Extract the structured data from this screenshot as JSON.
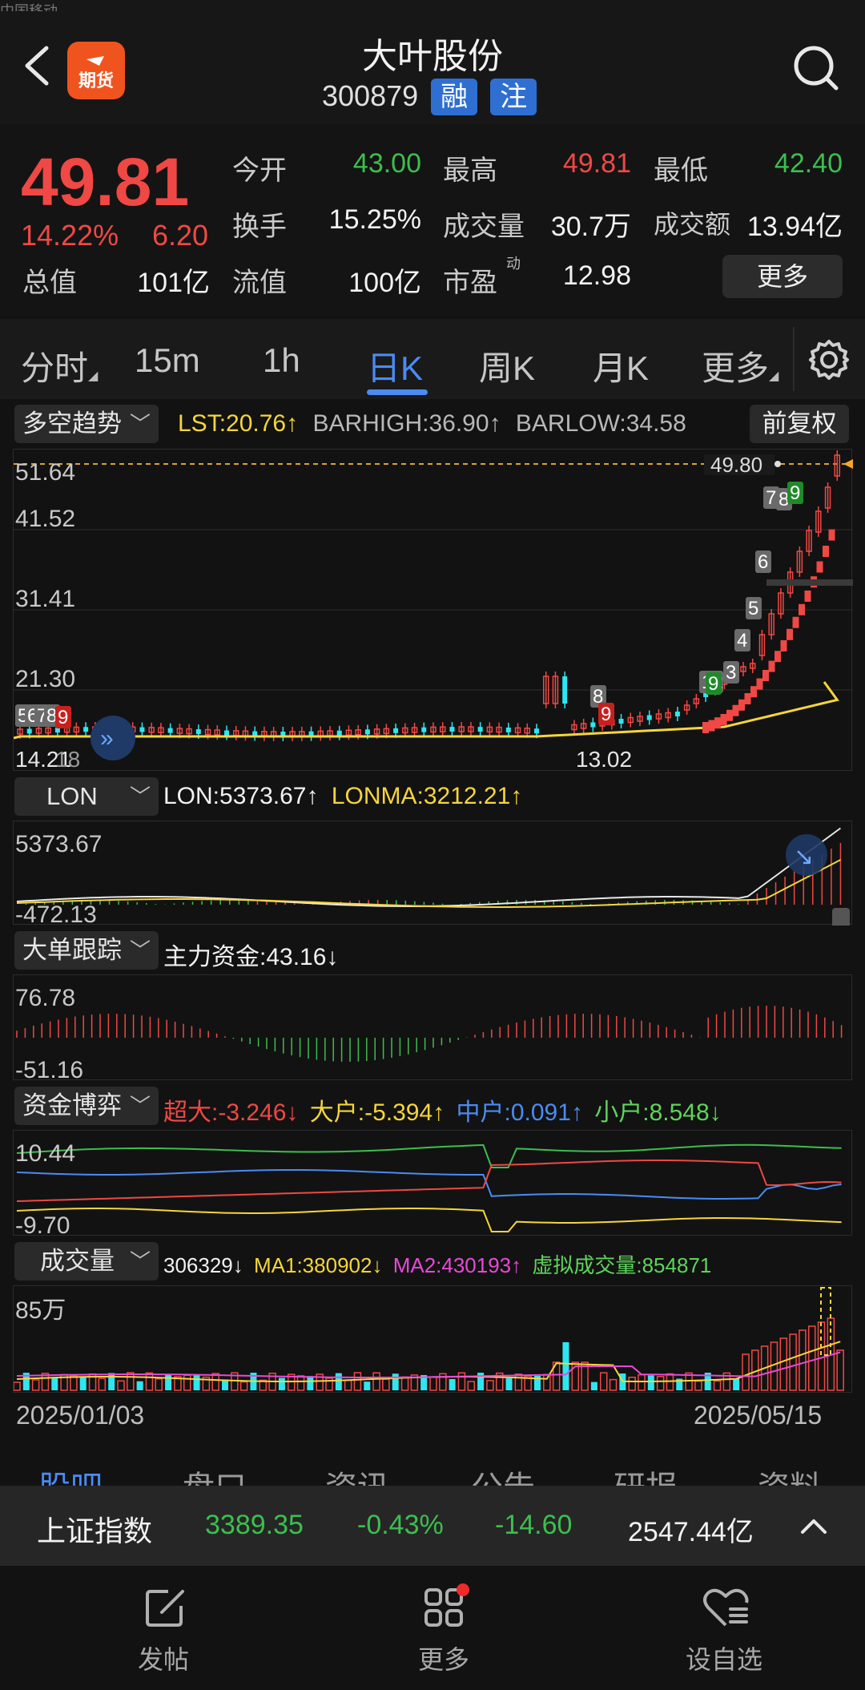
{
  "header": {
    "statusbar_text": "中国移动",
    "title": "大叶股份",
    "code": "300879",
    "tags": [
      "融",
      "注"
    ],
    "back_label": "‹",
    "futures_label": "期货"
  },
  "quote": {
    "price": "49.81",
    "change_pct": "14.22%",
    "change": "6.20",
    "rows": [
      [
        {
          "label": "今开",
          "value": "43.00",
          "color": "green"
        },
        {
          "label": "最高",
          "value": "49.81",
          "color": "red"
        },
        {
          "label": "最低",
          "value": "42.40",
          "color": "green"
        }
      ],
      [
        {
          "label": "换手",
          "value": "15.25%",
          "color": "white"
        },
        {
          "label": "成交量",
          "value": "30.7万",
          "color": "white"
        },
        {
          "label": "成交额",
          "value": "13.94亿",
          "color": "white"
        }
      ]
    ],
    "total_value_label": "总值",
    "total_value": "101亿",
    "float_value_label": "流值",
    "float_value": "100亿",
    "pe_label": "市盈",
    "pe_sup": "动",
    "pe_value": "12.98",
    "more_button": "更多"
  },
  "tabs": [
    "分时",
    "15m",
    "1h",
    "日K",
    "周K",
    "月K",
    "更多"
  ],
  "active_tab": "日K",
  "kline": {
    "indicator": "多空趋势",
    "lst": "LST:20.76↑",
    "barhigh": "BARHIGH:36.90↑",
    "barlow": "BARLOW:34.58",
    "fq_button": "前复权",
    "y_labels": [
      "51.64",
      "41.52",
      "31.41",
      "21.30"
    ],
    "last_price_tag": "49.80",
    "low_label_left": "14.21",
    "low_label_left2": "18",
    "low_label_mid": "13.02"
  },
  "lon": {
    "indicator": "LON",
    "lon": "LON:5373.67↑",
    "lonma": "LONMA:3212.21↑",
    "y_top": "5373.67",
    "y_bottom": "-472.13"
  },
  "bigorder": {
    "indicator": "大单跟踪",
    "main": "主力资金:43.16↓",
    "y_top": "76.78",
    "y_bottom": "-51.16"
  },
  "funds": {
    "indicator": "资金博弈",
    "super": "超大:-3.246↓",
    "large": "大户:-5.394↑",
    "medium": "中户:0.091↑",
    "small": "小户:8.548↓",
    "y_top": "10.44",
    "y_bottom": "-9.70"
  },
  "volume": {
    "indicator": "成交量",
    "vol": "306329↓",
    "ma1": "MA1:380902↓",
    "ma2": "MA2:430193↑",
    "virtual": "虚拟成交量:854871",
    "y_top": "85万"
  },
  "dates": {
    "start": "2025/01/03",
    "end": "2025/05/15"
  },
  "subtabs": [
    "股吧",
    "盘口",
    "资讯",
    "公告",
    "研报",
    "资料"
  ],
  "index_bar": {
    "name": "上证指数",
    "value": "3389.35",
    "pct": "-0.43%",
    "change": "-14.60",
    "amount": "2547.44亿"
  },
  "bottom_nav": [
    {
      "label": "发帖",
      "icon": "edit-icon"
    },
    {
      "label": "更多",
      "icon": "grid-icon"
    },
    {
      "label": "设自选",
      "icon": "heart-list-icon"
    }
  ],
  "colors": {
    "up": "#f04844",
    "down": "#3dbe4f",
    "accent": "#4a8bf5",
    "ma": "#f5d63a",
    "cyan": "#2ee6f0"
  }
}
